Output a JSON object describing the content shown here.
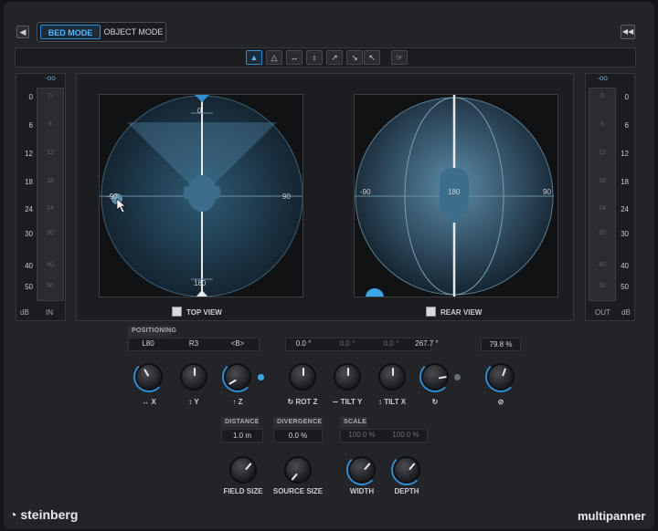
{
  "header": {
    "modes": [
      "BED MODE",
      "OBJECT MODE"
    ],
    "active_mode": "BED MODE",
    "back_icon": "chevron-left-icon",
    "skip_icon": "skip-to-start-icon"
  },
  "toolbar": {
    "tools": [
      "select-arrow-icon",
      "select-outline-icon",
      "horizontal-move-icon",
      "vertical-move-icon",
      "diagonal-move-icon",
      "diagonal-move-alt-icon",
      "free-arrow-icon",
      "link-cursor-icon"
    ],
    "active_tool_index": 0
  },
  "meter_in": {
    "peak": "-oo",
    "scale": [
      "0",
      "6",
      "12",
      "18",
      "24",
      "30",
      "40",
      "50"
    ],
    "inner_scale": [
      "0",
      "6",
      "12",
      "18",
      "24",
      "30",
      "40",
      "50"
    ],
    "unit": "dB",
    "label": "IN"
  },
  "meter_out": {
    "peak": "-oo",
    "scale": [
      "0",
      "6",
      "12",
      "18",
      "24",
      "30",
      "40",
      "50"
    ],
    "inner_scale": [
      "0",
      "6",
      "12",
      "18",
      "24",
      "30",
      "40",
      "50"
    ],
    "unit": "dB",
    "label": "OUT"
  },
  "top_view": {
    "label": "TOP VIEW",
    "axis": {
      "front": "0",
      "right": "90",
      "back": "180",
      "left": "-90"
    }
  },
  "rear_view": {
    "label": "REAR VIEW",
    "axis": {
      "center": "180",
      "right": "90",
      "left": "-90"
    }
  },
  "positioning": {
    "tag": "POSITIONING",
    "fields": [
      "L80",
      "R3",
      "<B>"
    ],
    "rotation_fields": [
      "0.0 °",
      "0.0 °",
      "0.0 °",
      "267.7 °"
    ],
    "extra_field": "79.8 %"
  },
  "knob_labels": [
    "X",
    "Y",
    "Z",
    "ROT Z",
    "TILT Y",
    "TILT X",
    ""
  ],
  "distance": {
    "tag": "DISTANCE",
    "value": "1.0 m"
  },
  "divergence": {
    "tag": "DIVERGENCE",
    "value": "0.0 %"
  },
  "scale": {
    "tag": "SCALE",
    "values": [
      "100.0 %",
      "100.0 %"
    ]
  },
  "bottom_knob_labels": [
    "FIELD SIZE",
    "SOURCE SIZE",
    "WIDTH",
    "DEPTH"
  ],
  "footer": {
    "brand": "steinberg",
    "product": "multipanner"
  },
  "colors": {
    "accent": "#2f8dd1",
    "background": "#232428"
  }
}
